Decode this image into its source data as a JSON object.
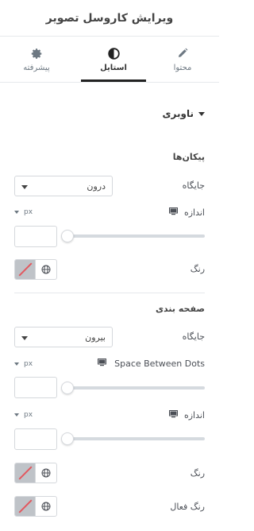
{
  "header": {
    "title": "ویرایش کاروسل تصویر"
  },
  "tabs": [
    {
      "label": "محتوا",
      "icon": "pencil-icon"
    },
    {
      "label": "استایل",
      "icon": "half-circle-contrast-icon",
      "active": true
    },
    {
      "label": "پیشرفته",
      "icon": "gear-icon"
    }
  ],
  "section": {
    "title": "ناوبری"
  },
  "arrows": {
    "heading": "پیکان‌ها",
    "position_label": "جایگاه",
    "position_value": "درون",
    "size_label": "اندازه",
    "size_unit": "px",
    "color_label": "رنگ"
  },
  "pagination": {
    "heading": "صفحه بندی",
    "position_label": "جایگاه",
    "position_value": "بیرون",
    "spacing_label": "Space Between Dots",
    "spacing_unit": "px",
    "size_label": "اندازه",
    "size_unit": "px",
    "color_label": "رنگ",
    "active_color_label": "رنگ فعال"
  },
  "colors": {
    "divider": "#e6e9ec",
    "swatch_empty": "#bfc3c8",
    "swatch_slash": "#e2585f",
    "active_tab_bar": "#222222"
  }
}
